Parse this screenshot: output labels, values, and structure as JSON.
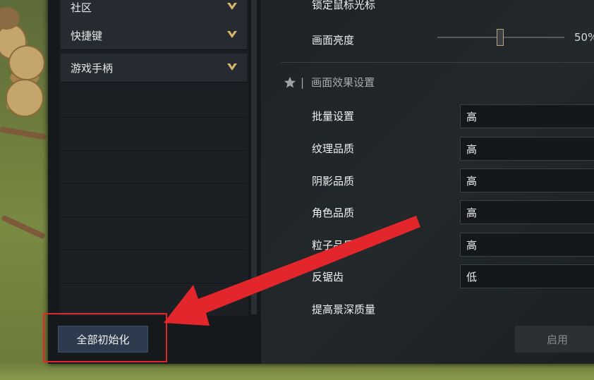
{
  "categories": [
    {
      "label": "社区"
    },
    {
      "label": "快捷键"
    },
    {
      "label": "游戏手柄"
    }
  ],
  "settings": {
    "lock_cursor_label": "锁定鼠标光标",
    "brightness_label": "画面亮度",
    "brightness_value": "50%",
    "brightness_level": 0.5,
    "section_title": "画面效果设置",
    "rows": [
      {
        "label": "批量设置",
        "value": "高"
      },
      {
        "label": "纹理品质",
        "value": "高"
      },
      {
        "label": "阴影品质",
        "value": "高"
      },
      {
        "label": "角色品质",
        "value": "高"
      },
      {
        "label": "粒子品质",
        "value": "高"
      },
      {
        "label": "反锯齿",
        "value": "低"
      },
      {
        "label": "提高景深质量"
      }
    ]
  },
  "buttons": {
    "reset_all": "全部初始化",
    "apply": "启用"
  },
  "colors": {
    "highlight": "#e3262b",
    "accent_gold": "#d9b66a"
  },
  "icons": {
    "chevron": "chevron-down-icon",
    "star": "star-icon"
  }
}
